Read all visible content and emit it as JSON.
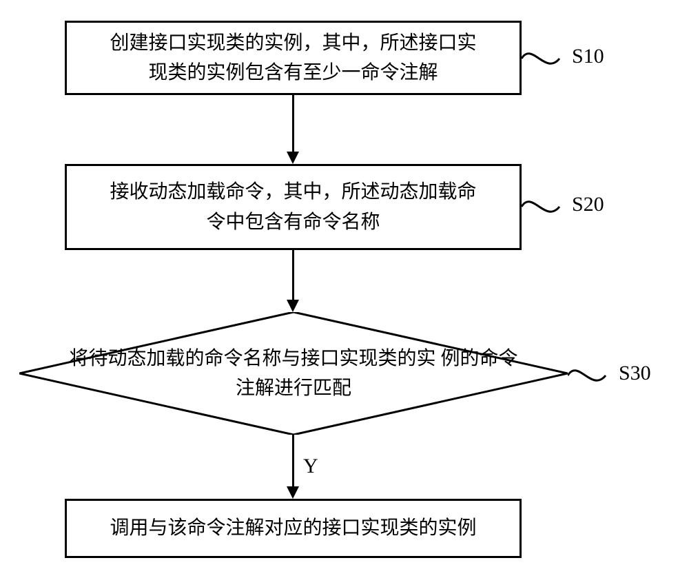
{
  "flowchart": {
    "steps": {
      "s10": {
        "label": "S10",
        "text": "创建接口实现类的实例，其中，所述接口实\n现类的实例包含有至少一命令注解"
      },
      "s20": {
        "label": "S20",
        "text": "接收动态加载命令，其中，所述动态加载命\n令中包含有命令名称"
      },
      "s30": {
        "label": "S30",
        "text": "将待动态加载的命令名称与接口实现类的实\n例的命令注解进行匹配"
      },
      "final": {
        "text": "调用与该命令注解对应的接口实现类的实例"
      }
    },
    "yes_label": "Y"
  }
}
